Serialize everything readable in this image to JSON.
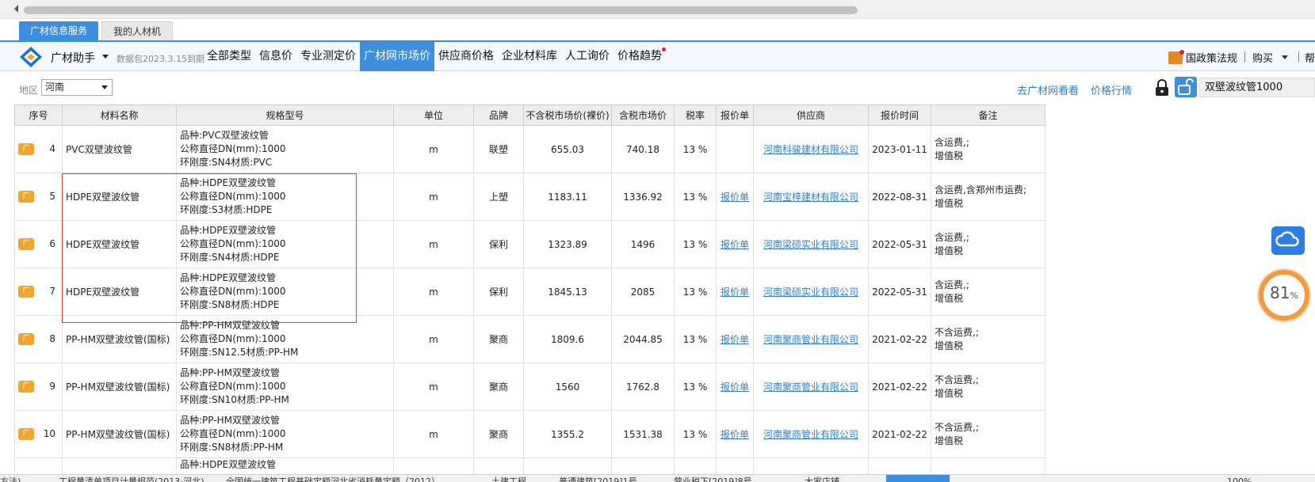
{
  "tabs": [
    {
      "label": "广材信息服务"
    },
    {
      "label": "我的人材机"
    }
  ],
  "navbar": {
    "brand": "广材助手",
    "package_info": "数据包2023.3.15到期",
    "items": [
      {
        "label": "全部类型"
      },
      {
        "label": "信息价"
      },
      {
        "label": "专业测定价"
      },
      {
        "label": "广材网市场价"
      },
      {
        "label": "供应商价格"
      },
      {
        "label": "企业材料库"
      },
      {
        "label": "人工询价"
      },
      {
        "label": "价格趋势"
      }
    ],
    "policy": "国政策法规",
    "buy": "购买",
    "help": "帮"
  },
  "filter": {
    "region_label": "地区",
    "region_value": "河南",
    "link_gcw": "去广材网看看",
    "link_trend": "价格行情",
    "search_value": "双壁波纹管1000"
  },
  "table": {
    "headers": [
      "序号",
      "材料名称",
      "规格型号",
      "单位",
      "品牌",
      "不含税市场价(裸价)",
      "含税市场价",
      "税率",
      "报价单",
      "供应商",
      "报价时间",
      "备注"
    ],
    "tag_label": "广",
    "rows": [
      {
        "idx": "4",
        "name": "PVC双壁波纹管",
        "spec1": "品种:PVC双壁波纹管",
        "spec2": "公称直径DN(mm):1000",
        "spec3": "环刚度:SN4材质:PVC",
        "unit": "m",
        "brand": "联塑",
        "price_ex": "655.03",
        "price_in": "740.18",
        "tax": "13 %",
        "quote": "",
        "supplier": "河南科骏建材有限公司",
        "date": "2023-01-11",
        "note1": "含运费,;",
        "note2": "增值税"
      },
      {
        "idx": "5",
        "name": "HDPE双壁波纹管",
        "spec1": "品种:HDPE双壁波纹管",
        "spec2": "公称直径DN(mm):1000",
        "spec3": "环刚度:S3材质:HDPE",
        "unit": "m",
        "brand": "上塑",
        "price_ex": "1183.11",
        "price_in": "1336.92",
        "tax": "13 %",
        "quote": "报价单",
        "supplier": "河南宝梓建材有限公司",
        "date": "2022-08-31",
        "note1": "含运费,含郑州市运费;",
        "note2": "增值税"
      },
      {
        "idx": "6",
        "name": "HDPE双壁波纹管",
        "spec1": "品种:HDPE双壁波纹管",
        "spec2": "公称直径DN(mm):1000",
        "spec3": "环刚度:SN4材质:HDPE",
        "unit": "m",
        "brand": "保利",
        "price_ex": "1323.89",
        "price_in": "1496",
        "tax": "13 %",
        "quote": "报价单",
        "supplier": "河南梁硕实业有限公司",
        "date": "2022-05-31",
        "note1": "含运费,;",
        "note2": "增值税"
      },
      {
        "idx": "7",
        "name": "HDPE双壁波纹管",
        "spec1": "品种:HDPE双壁波纹管",
        "spec2": "公称直径DN(mm):1000",
        "spec3": "环刚度:SN8材质:HDPE",
        "unit": "m",
        "brand": "保利",
        "price_ex": "1845.13",
        "price_in": "2085",
        "tax": "13 %",
        "quote": "报价单",
        "supplier": "河南梁硕实业有限公司",
        "date": "2022-05-31",
        "note1": "含运费,;",
        "note2": "增值税"
      },
      {
        "idx": "8",
        "name": "PP-HM双壁波纹管(国标)",
        "spec1": "品种:PP-HM双壁波纹管",
        "spec2": "公称直径DN(mm):1000",
        "spec3": "环刚度:SN12.5材质:PP-HM",
        "unit": "m",
        "brand": "聚商",
        "price_ex": "1809.6",
        "price_in": "2044.85",
        "tax": "13 %",
        "quote": "报价单",
        "supplier": "河南聚商管业有限公司",
        "date": "2021-02-22",
        "note1": "不含运费,;",
        "note2": "增值税"
      },
      {
        "idx": "9",
        "name": "PP-HM双壁波纹管(国标)",
        "spec1": "品种:PP-HM双壁波纹管",
        "spec2": "公称直径DN(mm):1000",
        "spec3": "环刚度:SN10材质:PP-HM",
        "unit": "m",
        "brand": "聚商",
        "price_ex": "1560",
        "price_in": "1762.8",
        "tax": "13 %",
        "quote": "报价单",
        "supplier": "河南聚商管业有限公司",
        "date": "2021-02-22",
        "note1": "不含运费,;",
        "note2": "增值税"
      },
      {
        "idx": "10",
        "name": "PP-HM双壁波纹管(国标)",
        "spec1": "品种:PP-HM双壁波纹管",
        "spec2": "公称直径DN(mm):1000",
        "spec3": "环刚度:SN8材质:PP-HM",
        "unit": "m",
        "brand": "聚商",
        "price_ex": "1355.2",
        "price_in": "1531.38",
        "tax": "13 %",
        "quote": "报价单",
        "supplier": "河南聚商管业有限公司",
        "date": "2021-02-22",
        "note1": "不含运费,;",
        "note2": "增值税"
      }
    ],
    "partial_row_spec": "品种:HDPE双壁波纹管"
  },
  "widgets": {
    "speed_value": "81",
    "speed_unit": "%"
  },
  "statusbar": {
    "items": [
      "方法)",
      "工程量清单项目计量规范(2013-河北)",
      "全国统一建筑工程基础定额河北省消耗量定额（2012）",
      "土建工程",
      "普通建筑[2019]1号",
      "营业税下[2019]8号",
      "大家店铺",
      "100%"
    ]
  },
  "colors": {
    "accent": "#3b8ee0",
    "link": "#2f7ed8",
    "tag": "#f4a428",
    "highlight_box": "#e23c3c",
    "ring": "#f39a3c"
  }
}
